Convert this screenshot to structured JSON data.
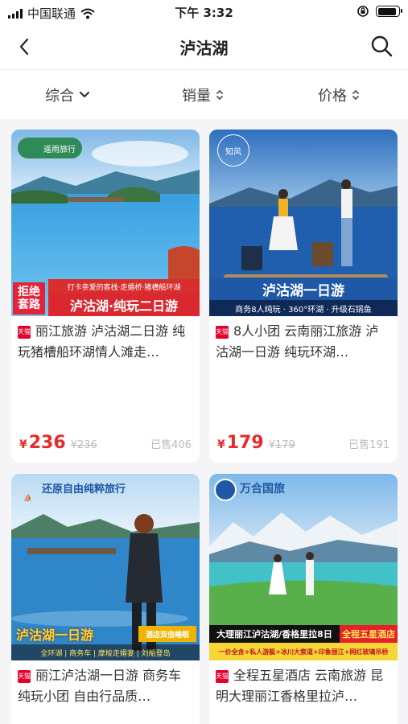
{
  "status_bar": {
    "carrier": "中国联通",
    "time": "下午 3:32"
  },
  "nav": {
    "title": "泸沽湖",
    "back_icon": "chevron-left-icon",
    "search_icon": "search-icon"
  },
  "sort": [
    {
      "label": "综合",
      "icon": "chevron-down-icon"
    },
    {
      "label": "销量",
      "icon": "sort-updown-icon"
    },
    {
      "label": "价格",
      "icon": "sort-updown-icon"
    }
  ],
  "products": [
    {
      "brand": "遥雨旅行",
      "image_banner_main": "泸沽湖·纯玩二日游",
      "image_banner_sub": "打卡亲爱的客栈·走婚桥·猪槽船环湖",
      "image_badge": "拒绝套路",
      "badge": "天猫",
      "title": "丽江旅游 泸沽湖二日游 纯玩猪槽船环湖情人滩走…",
      "currency": "¥",
      "price": "236",
      "original_price": "¥236",
      "sold": "已售406"
    },
    {
      "brand": "知风",
      "image_banner_main": "泸沽湖一日游",
      "image_banner_sub": "商务8人纯玩 · 360°环湖 · 升级石锅鱼",
      "badge": "天猫",
      "title": "8人小团 云南丽江旅游 泸沽湖一日游 纯玩环湖…",
      "currency": "¥",
      "price": "179",
      "original_price": "¥179",
      "sold": "已售191"
    },
    {
      "brand": "还原自由纯粹旅行",
      "image_banner_main": "泸沽湖一日游",
      "image_banner_tag": "酒店双倍睡眠",
      "image_banner_sub": "全环湖 | 商务车 | 摩梭走婚宴 | 刘船登岛",
      "badge": "天猫",
      "title": "丽江泸沽湖一日游 商务车纯玩小团 自由行品质…"
    },
    {
      "brand": "万合国旅",
      "image_banner_main": "大理丽江泸沽湖/香格里拉8日",
      "image_banner_tag": "全程五星酒店",
      "image_banner_sub": "一价全含+私人游艇+冰川大索道+印象丽江+网红玻璃吊桥",
      "badge": "天猫",
      "title": "全程五星酒店 云南旅游 昆明大理丽江香格里拉泸…"
    }
  ],
  "colors": {
    "price": "#e52b2b",
    "tmall": "#e4002b",
    "banner_red": "#d9282f",
    "banner_blue": "#1e58a6"
  }
}
